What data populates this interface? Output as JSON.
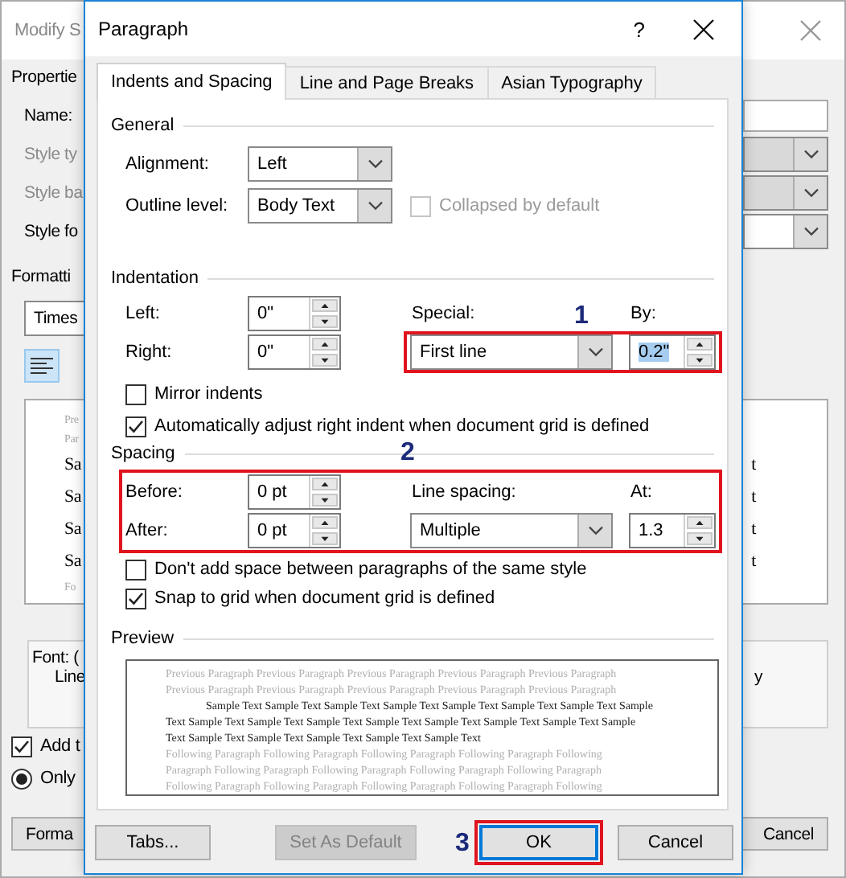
{
  "background_dialog": {
    "title": "Modify S",
    "properties_heading": "Propertie",
    "property_rows": [
      {
        "label": "Name:",
        "kind": "text",
        "disabled": false
      },
      {
        "label": "Style ty",
        "kind": "combo",
        "disabled": true
      },
      {
        "label": "Style ba",
        "kind": "combo",
        "disabled": true
      },
      {
        "label": "Style fo",
        "kind": "combo",
        "disabled": false
      }
    ],
    "formatting_heading": "Formatti",
    "font_combo": "Times",
    "preview_rows": [
      {
        "left": "Pre",
        "kind": "faint"
      },
      {
        "left": "Par",
        "kind": "faint"
      },
      {
        "left": "Sa",
        "right": "t",
        "kind": "sample"
      },
      {
        "left": "Sa",
        "right": "t",
        "kind": "sample"
      },
      {
        "left": "Sa",
        "right": "t",
        "kind": "sample"
      },
      {
        "left": "Sa",
        "right": "t",
        "kind": "sample"
      },
      {
        "left": "Fo",
        "kind": "faint"
      }
    ],
    "description_lines": [
      "Font: (",
      "Line"
    ],
    "description_right": "y",
    "add_checkbox": {
      "label": "Add t",
      "checked": true
    },
    "only_radio": {
      "label": "Only",
      "selected": true
    },
    "buttons": [
      "Forma",
      "Cancel"
    ]
  },
  "dialog": {
    "title": "Paragraph",
    "help": "?",
    "tabs": [
      {
        "label": "Indents and Spacing",
        "selected": true
      },
      {
        "label": "Line and Page Breaks",
        "selected": false
      },
      {
        "label": "Asian Typography",
        "selected": false
      }
    ],
    "general": {
      "heading": "General",
      "alignment": {
        "label": "Alignment:",
        "value": "Left"
      },
      "outline_level": {
        "label": "Outline level:",
        "value": "Body Text"
      },
      "collapsed": {
        "label": "Collapsed by default",
        "checked": false,
        "disabled": true
      }
    },
    "indentation": {
      "heading": "Indentation",
      "left": {
        "label": "Left:",
        "value": "0\""
      },
      "right": {
        "label": "Right:",
        "value": "0\""
      },
      "special": {
        "label": "Special:",
        "value": "First line"
      },
      "by": {
        "label": "By:",
        "value": "0.2\"",
        "selected": true
      },
      "mirror": {
        "label": "Mirror indents",
        "checked": false
      },
      "auto_adjust": {
        "label": "Automatically adjust right indent when document grid is defined",
        "checked": true
      }
    },
    "spacing": {
      "heading": "Spacing",
      "before": {
        "label": "Before:",
        "value": "0 pt"
      },
      "after": {
        "label": "After:",
        "value": "0 pt"
      },
      "line_spacing": {
        "label": "Line spacing:",
        "value": "Multiple"
      },
      "at": {
        "label": "At:",
        "value": "1.3"
      },
      "dont_add": {
        "label": "Don't add space between paragraphs of the same style",
        "checked": false
      },
      "snap": {
        "label": "Snap to grid when document grid is defined",
        "checked": true
      }
    },
    "preview": {
      "heading": "Preview",
      "lines": [
        {
          "text": "Previous Paragraph Previous Paragraph Previous Paragraph Previous Paragraph Previous Paragraph",
          "kind": "other"
        },
        {
          "text": "Previous Paragraph Previous Paragraph Previous Paragraph Previous Paragraph Previous Paragraph",
          "kind": "other"
        },
        {
          "text": "Sample Text Sample Text Sample Text Sample Text Sample Text Sample Text Sample Text Sample",
          "kind": "first"
        },
        {
          "text": "Text Sample Text Sample Text Sample Text Sample Text Sample Text Sample Text Sample Text Sample",
          "kind": "sample"
        },
        {
          "text": "Text Sample Text Sample Text Sample Text Sample Text Sample Text",
          "kind": "sample"
        },
        {
          "text": "Following Paragraph Following Paragraph Following Paragraph Following Paragraph Following",
          "kind": "other"
        },
        {
          "text": "Paragraph Following Paragraph Following Paragraph Following Paragraph Following Paragraph",
          "kind": "other"
        },
        {
          "text": "Following Paragraph Following Paragraph Following Paragraph Following Paragraph Following",
          "kind": "other"
        }
      ]
    },
    "buttons": [
      {
        "label": "Tabs...",
        "disabled": false,
        "default": false
      },
      {
        "label": "Set As Default",
        "disabled": true,
        "default": false
      },
      {
        "label": "OK",
        "disabled": false,
        "default": true
      },
      {
        "label": "Cancel",
        "disabled": false,
        "default": false
      }
    ]
  },
  "annotations": [
    {
      "number": "1"
    },
    {
      "number": "2"
    },
    {
      "number": "3"
    }
  ]
}
